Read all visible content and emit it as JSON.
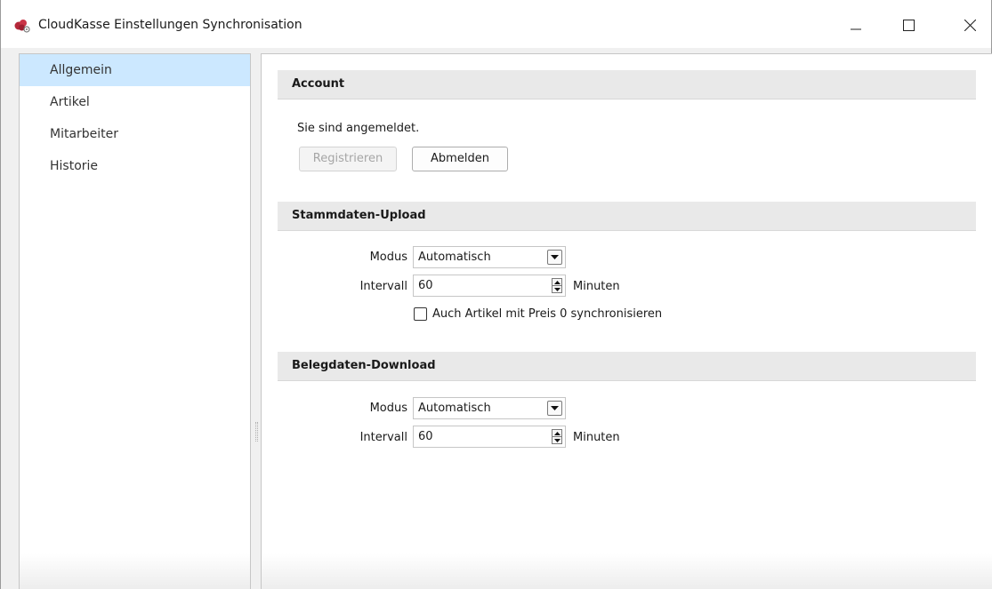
{
  "window": {
    "title": "CloudKasse Einstellungen Synchronisation",
    "controls": {
      "minimize": "minimize-icon",
      "maximize": "maximize-icon",
      "close": "close-icon"
    }
  },
  "sidebar": {
    "items": [
      {
        "label": "Allgemein",
        "selected": true
      },
      {
        "label": "Artikel",
        "selected": false
      },
      {
        "label": "Mitarbeiter",
        "selected": false
      },
      {
        "label": "Historie",
        "selected": false
      }
    ],
    "selected_color": "#cce8ff"
  },
  "account": {
    "header": "Account",
    "status_text": "Sie sind angemeldet.",
    "register_label": "Registrieren",
    "logout_label": "Abmelden"
  },
  "upload": {
    "header": "Stammdaten-Upload",
    "mode_label": "Modus",
    "mode_value": "Automatisch",
    "interval_label": "Intervall",
    "interval_value": "60",
    "interval_unit": "Minuten",
    "checkbox_label": "Auch Artikel mit Preis 0 synchronisieren",
    "checkbox_checked": false
  },
  "download": {
    "header": "Belegdaten-Download",
    "mode_label": "Modus",
    "mode_value": "Automatisch",
    "interval_label": "Intervall",
    "interval_value": "60",
    "interval_unit": "Minuten"
  },
  "colors": {
    "brand_icon": "#b5283a",
    "section_header_bg": "#e9e9e9"
  }
}
